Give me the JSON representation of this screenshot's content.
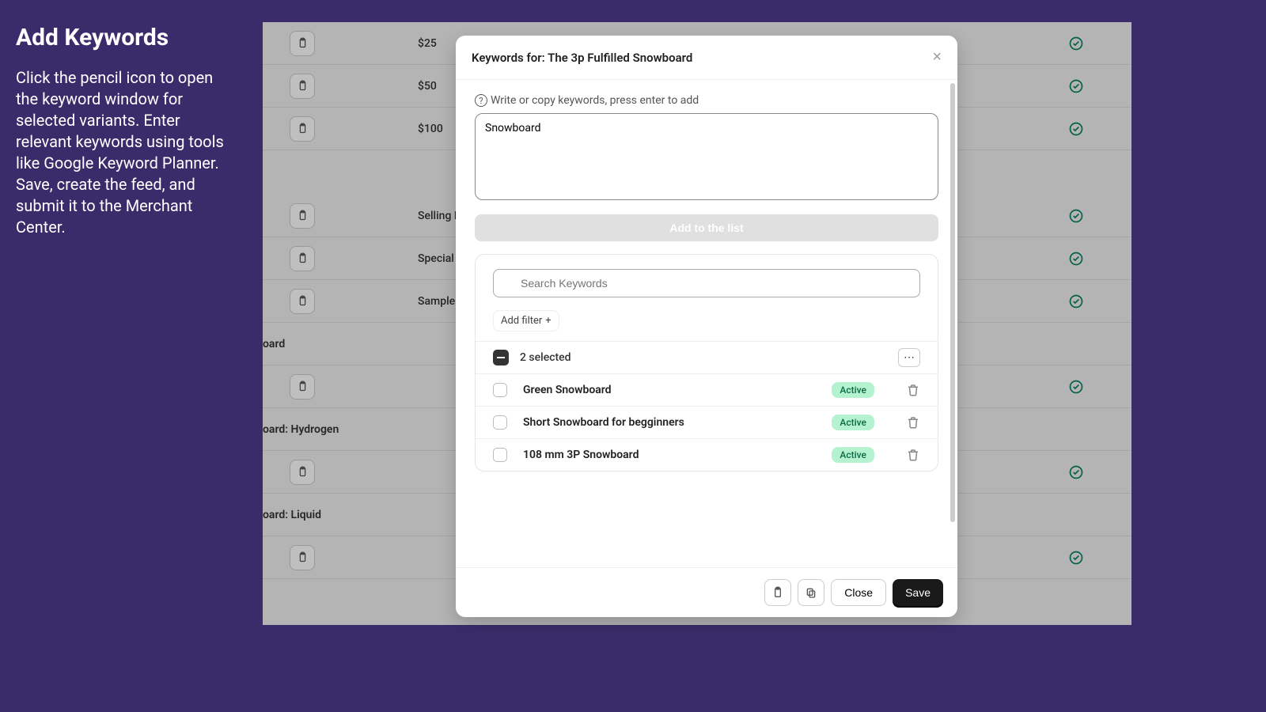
{
  "sidebar": {
    "title": "Add Keywords",
    "body": "Click the pencil icon to open the keyword window for selected variants. Enter relevant keywords using tools like Google Keyword Planner. Save, create the feed, and submit it to the Merchant Center."
  },
  "background_rows": [
    {
      "label": "$25"
    },
    {
      "label": "$50"
    },
    {
      "label": "$100"
    },
    {
      "label": "Selling Plans S"
    },
    {
      "label": "Special Selling"
    },
    {
      "label": "Sample Selling"
    },
    {
      "label": ""
    },
    {
      "label": ""
    },
    {
      "label": ""
    }
  ],
  "background_groups": {
    "g1": "oard",
    "g2": "oard: Hydrogen",
    "g3": "oard: Liquid"
  },
  "modal": {
    "title": "Keywords for: The 3p Fulfilled Snowboard",
    "input_label": "Write or copy keywords, press enter to add",
    "textarea_value": "Snowboard",
    "add_button": "Add to the list",
    "search_placeholder": "Search Keywords",
    "add_filter": "Add filter",
    "selected_text": "2 selected",
    "keywords": [
      {
        "label": "Green Snowboard",
        "status": "Active"
      },
      {
        "label": "Short Snowboard for begginners",
        "status": "Active"
      },
      {
        "label": "108 mm 3P Snowboard",
        "status": "Active"
      }
    ],
    "close": "Close",
    "save": "Save"
  }
}
